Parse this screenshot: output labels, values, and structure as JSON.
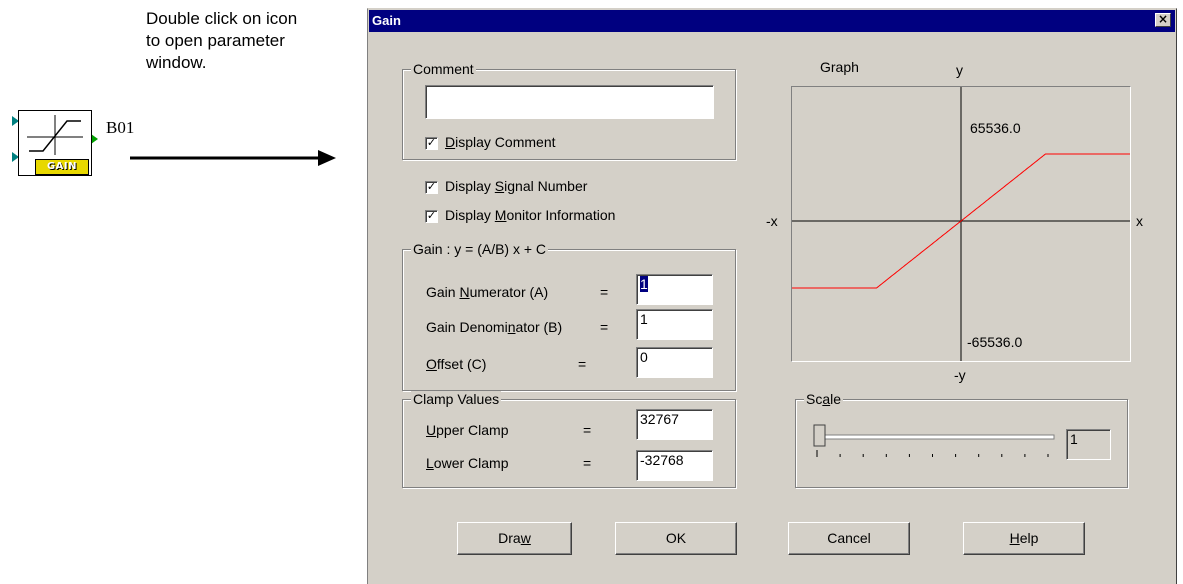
{
  "instruction": {
    "line1": "Double click on icon",
    "line2": "to open parameter",
    "line3": "window."
  },
  "block": {
    "label": "GAIN",
    "id": "B01"
  },
  "dialog": {
    "title": "Gain",
    "close_glyph": "×",
    "comment": {
      "group_label": "Comment",
      "value": "",
      "display_comment": {
        "pre": "",
        "ul": "D",
        "post": "isplay Comment",
        "checked": true
      }
    },
    "display_signal_number": {
      "pre": "Display ",
      "ul": "S",
      "post": "ignal Number",
      "checked": true
    },
    "display_monitor_info": {
      "pre": "Display ",
      "ul": "M",
      "post": "onitor Information",
      "checked": true
    },
    "gain": {
      "group_label": "Gain :  y = (A/B) x + C",
      "numerator": {
        "pre": "Gain ",
        "ul": "N",
        "post": "umerator (A)",
        "eq": "=",
        "value": "1"
      },
      "denominator": {
        "pre": "Gain Denomi",
        "ul": "n",
        "post": "ator (B)",
        "eq": "=",
        "value": "1"
      },
      "offset": {
        "pre": "",
        "ul": "O",
        "post": "ffset (C)",
        "eq": "=",
        "value": "0"
      }
    },
    "clamp": {
      "group_label": "Clamp Values",
      "upper": {
        "pre": "",
        "ul": "U",
        "post": "pper Clamp",
        "eq": "=",
        "value": "32767"
      },
      "lower": {
        "pre": "",
        "ul": "L",
        "post": "ower Clamp",
        "eq": "=",
        "value": "-32768"
      }
    },
    "graph": {
      "title": "Graph",
      "y_label": "y",
      "neg_y_label": "-y",
      "x_label": "x",
      "neg_x_label": "-x",
      "y_max": "65536.0",
      "y_min": "-65536.0",
      "line_color": "#ff0000"
    },
    "scale": {
      "group_label_pre": "Sc",
      "group_label_ul": "a",
      "group_label_post": "le",
      "value": "1",
      "slider_position": 0
    },
    "buttons": {
      "draw": {
        "pre": "Dra",
        "ul": "w",
        "post": ""
      },
      "ok": {
        "pre": "OK",
        "ul": "",
        "post": ""
      },
      "cancel": {
        "pre": "Cancel",
        "ul": "",
        "post": ""
      },
      "help": {
        "pre": "",
        "ul": "H",
        "post": "elp"
      }
    }
  }
}
